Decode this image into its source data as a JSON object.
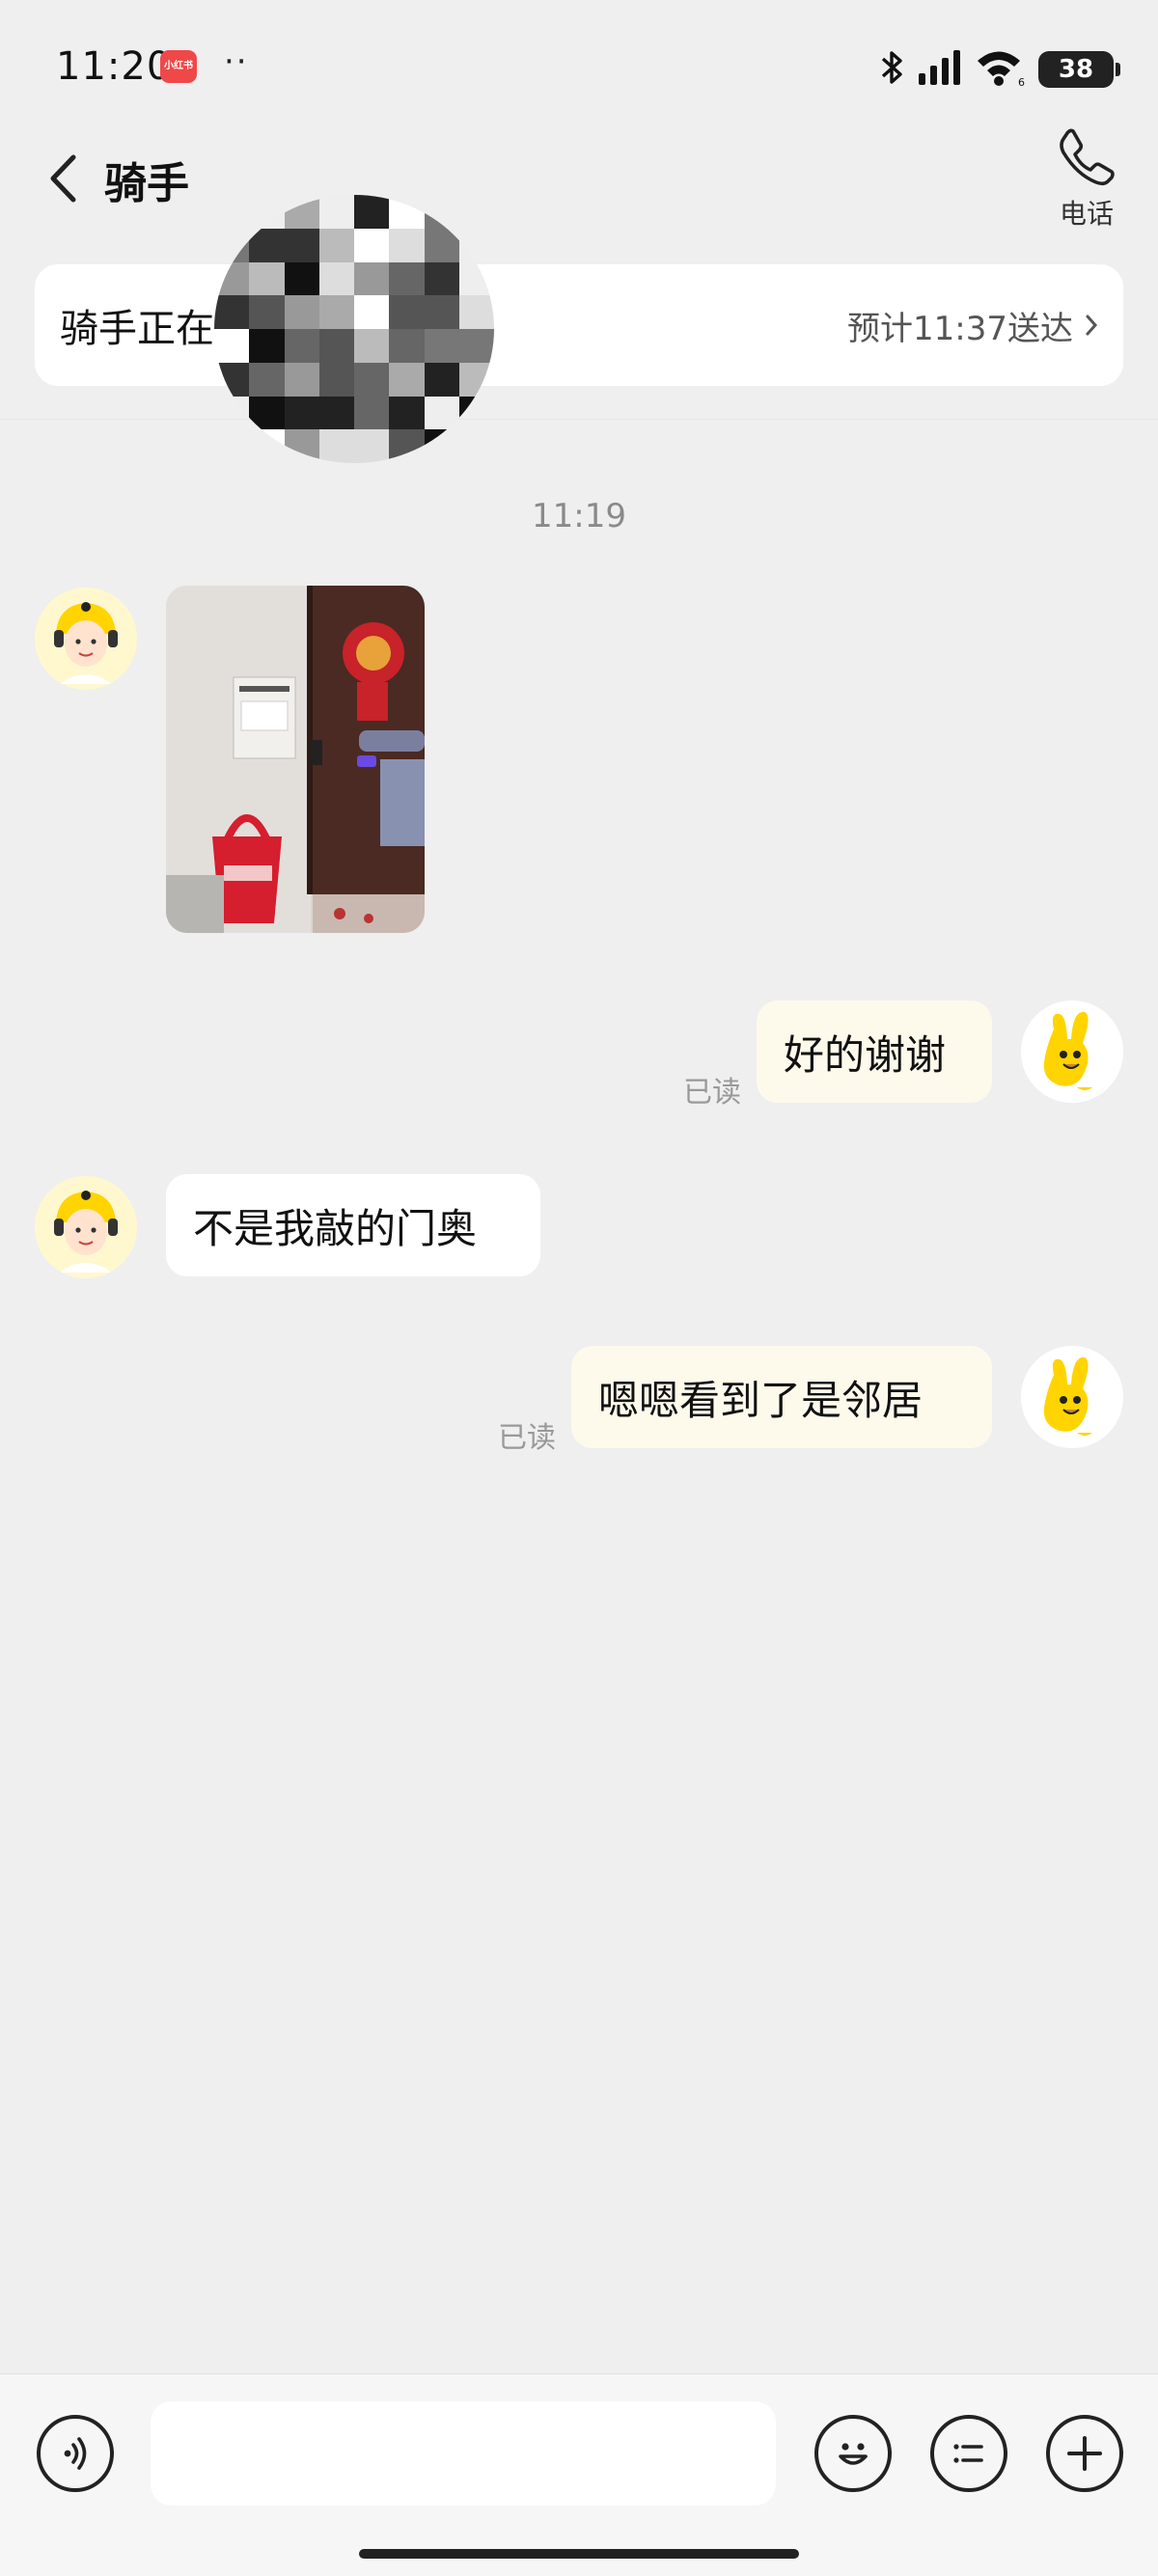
{
  "status_bar": {
    "time": "11:20",
    "app_badge": "小红书",
    "dots": "··",
    "battery": "38"
  },
  "nav": {
    "title": "骑手",
    "call_label": "电话"
  },
  "delivery": {
    "status": "骑手正在送货",
    "eta": "预计11:37送达"
  },
  "chat": {
    "timestamp": "11:19",
    "messages": [
      {
        "from": "rider",
        "type": "image"
      },
      {
        "from": "me",
        "type": "text",
        "text": "好的谢谢",
        "read": "已读"
      },
      {
        "from": "rider",
        "type": "text",
        "text": "不是我敲的门奥"
      },
      {
        "from": "me",
        "type": "text",
        "text": "嗯嗯看到了是邻居",
        "read": "已读"
      }
    ]
  },
  "input": {
    "placeholder": ""
  },
  "colors": {
    "background": "#efefef",
    "bubble_out": "#fdfaec",
    "bubble_in": "#ffffff",
    "accent_yellow": "#ffd400"
  },
  "icons": [
    "back-chevron-icon",
    "phone-icon",
    "chevron-right-icon",
    "voice-icon",
    "emoji-icon",
    "quick-reply-icon",
    "plus-icon"
  ]
}
